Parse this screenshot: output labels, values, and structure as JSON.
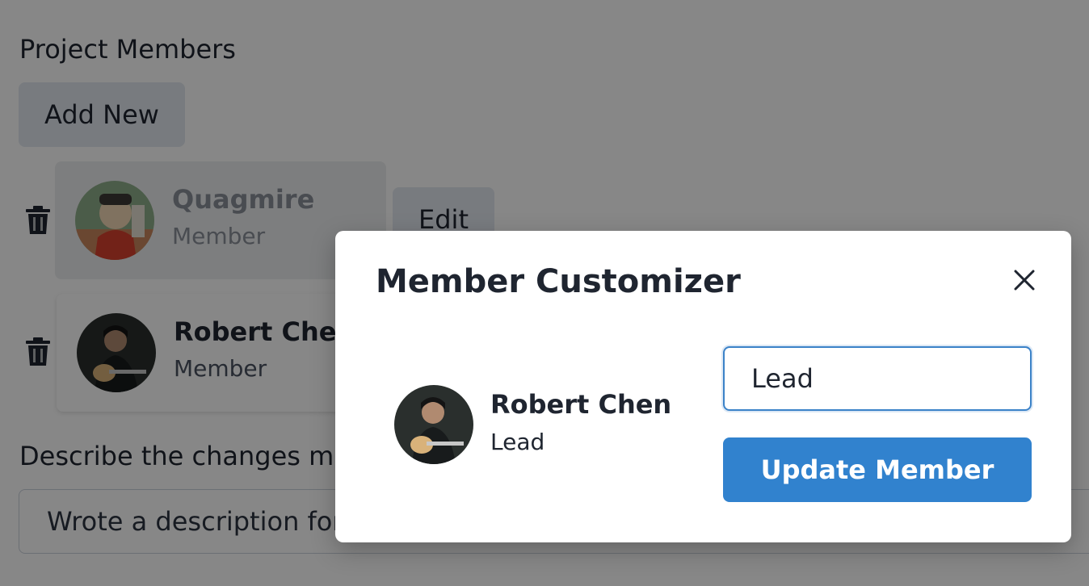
{
  "page": {
    "section_title": "Project Members",
    "add_button": "Add New",
    "members": [
      {
        "name": "Quagmire",
        "role": "Member"
      },
      {
        "name": "Robert Chen",
        "role": "Member"
      }
    ],
    "edit_button": "Edit",
    "description_label": "Describe the changes mac",
    "description_value": "Wrote a description for"
  },
  "modal": {
    "title": "Member Customizer",
    "member_name": "Robert Chen",
    "member_role": "Lead",
    "role_input_value": "Lead",
    "update_button": "Update Member"
  },
  "icons": {
    "trash": "trash-icon",
    "close": "close-icon"
  },
  "colors": {
    "primary": "#3182ce",
    "button_secondary": "#e2e8f0",
    "overlay": "rgba(0,0,0,0.47)"
  }
}
